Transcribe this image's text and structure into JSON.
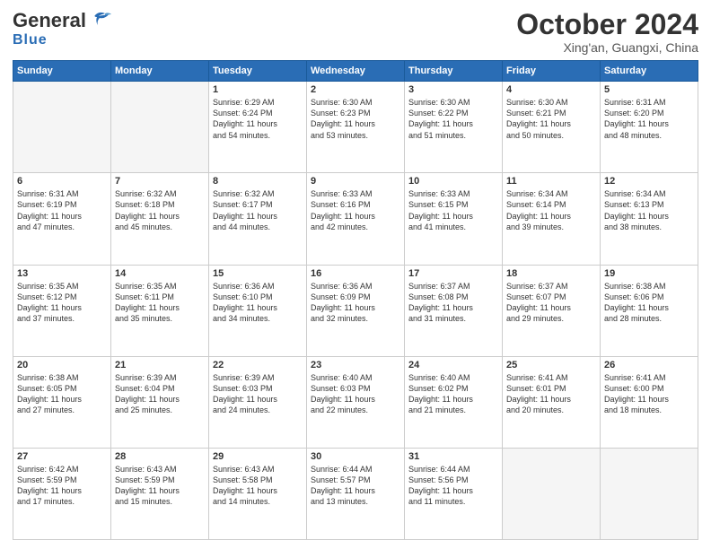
{
  "header": {
    "logo_line1": "General",
    "logo_line2": "Blue",
    "month_title": "October 2024",
    "location": "Xing'an, Guangxi, China"
  },
  "weekdays": [
    "Sunday",
    "Monday",
    "Tuesday",
    "Wednesday",
    "Thursday",
    "Friday",
    "Saturday"
  ],
  "weeks": [
    [
      {
        "day": "",
        "lines": [],
        "empty": true
      },
      {
        "day": "",
        "lines": [],
        "empty": true
      },
      {
        "day": "1",
        "lines": [
          "Sunrise: 6:29 AM",
          "Sunset: 6:24 PM",
          "Daylight: 11 hours",
          "and 54 minutes."
        ],
        "empty": false
      },
      {
        "day": "2",
        "lines": [
          "Sunrise: 6:30 AM",
          "Sunset: 6:23 PM",
          "Daylight: 11 hours",
          "and 53 minutes."
        ],
        "empty": false
      },
      {
        "day": "3",
        "lines": [
          "Sunrise: 6:30 AM",
          "Sunset: 6:22 PM",
          "Daylight: 11 hours",
          "and 51 minutes."
        ],
        "empty": false
      },
      {
        "day": "4",
        "lines": [
          "Sunrise: 6:30 AM",
          "Sunset: 6:21 PM",
          "Daylight: 11 hours",
          "and 50 minutes."
        ],
        "empty": false
      },
      {
        "day": "5",
        "lines": [
          "Sunrise: 6:31 AM",
          "Sunset: 6:20 PM",
          "Daylight: 11 hours",
          "and 48 minutes."
        ],
        "empty": false
      }
    ],
    [
      {
        "day": "6",
        "lines": [
          "Sunrise: 6:31 AM",
          "Sunset: 6:19 PM",
          "Daylight: 11 hours",
          "and 47 minutes."
        ],
        "empty": false
      },
      {
        "day": "7",
        "lines": [
          "Sunrise: 6:32 AM",
          "Sunset: 6:18 PM",
          "Daylight: 11 hours",
          "and 45 minutes."
        ],
        "empty": false
      },
      {
        "day": "8",
        "lines": [
          "Sunrise: 6:32 AM",
          "Sunset: 6:17 PM",
          "Daylight: 11 hours",
          "and 44 minutes."
        ],
        "empty": false
      },
      {
        "day": "9",
        "lines": [
          "Sunrise: 6:33 AM",
          "Sunset: 6:16 PM",
          "Daylight: 11 hours",
          "and 42 minutes."
        ],
        "empty": false
      },
      {
        "day": "10",
        "lines": [
          "Sunrise: 6:33 AM",
          "Sunset: 6:15 PM",
          "Daylight: 11 hours",
          "and 41 minutes."
        ],
        "empty": false
      },
      {
        "day": "11",
        "lines": [
          "Sunrise: 6:34 AM",
          "Sunset: 6:14 PM",
          "Daylight: 11 hours",
          "and 39 minutes."
        ],
        "empty": false
      },
      {
        "day": "12",
        "lines": [
          "Sunrise: 6:34 AM",
          "Sunset: 6:13 PM",
          "Daylight: 11 hours",
          "and 38 minutes."
        ],
        "empty": false
      }
    ],
    [
      {
        "day": "13",
        "lines": [
          "Sunrise: 6:35 AM",
          "Sunset: 6:12 PM",
          "Daylight: 11 hours",
          "and 37 minutes."
        ],
        "empty": false
      },
      {
        "day": "14",
        "lines": [
          "Sunrise: 6:35 AM",
          "Sunset: 6:11 PM",
          "Daylight: 11 hours",
          "and 35 minutes."
        ],
        "empty": false
      },
      {
        "day": "15",
        "lines": [
          "Sunrise: 6:36 AM",
          "Sunset: 6:10 PM",
          "Daylight: 11 hours",
          "and 34 minutes."
        ],
        "empty": false
      },
      {
        "day": "16",
        "lines": [
          "Sunrise: 6:36 AM",
          "Sunset: 6:09 PM",
          "Daylight: 11 hours",
          "and 32 minutes."
        ],
        "empty": false
      },
      {
        "day": "17",
        "lines": [
          "Sunrise: 6:37 AM",
          "Sunset: 6:08 PM",
          "Daylight: 11 hours",
          "and 31 minutes."
        ],
        "empty": false
      },
      {
        "day": "18",
        "lines": [
          "Sunrise: 6:37 AM",
          "Sunset: 6:07 PM",
          "Daylight: 11 hours",
          "and 29 minutes."
        ],
        "empty": false
      },
      {
        "day": "19",
        "lines": [
          "Sunrise: 6:38 AM",
          "Sunset: 6:06 PM",
          "Daylight: 11 hours",
          "and 28 minutes."
        ],
        "empty": false
      }
    ],
    [
      {
        "day": "20",
        "lines": [
          "Sunrise: 6:38 AM",
          "Sunset: 6:05 PM",
          "Daylight: 11 hours",
          "and 27 minutes."
        ],
        "empty": false
      },
      {
        "day": "21",
        "lines": [
          "Sunrise: 6:39 AM",
          "Sunset: 6:04 PM",
          "Daylight: 11 hours",
          "and 25 minutes."
        ],
        "empty": false
      },
      {
        "day": "22",
        "lines": [
          "Sunrise: 6:39 AM",
          "Sunset: 6:03 PM",
          "Daylight: 11 hours",
          "and 24 minutes."
        ],
        "empty": false
      },
      {
        "day": "23",
        "lines": [
          "Sunrise: 6:40 AM",
          "Sunset: 6:03 PM",
          "Daylight: 11 hours",
          "and 22 minutes."
        ],
        "empty": false
      },
      {
        "day": "24",
        "lines": [
          "Sunrise: 6:40 AM",
          "Sunset: 6:02 PM",
          "Daylight: 11 hours",
          "and 21 minutes."
        ],
        "empty": false
      },
      {
        "day": "25",
        "lines": [
          "Sunrise: 6:41 AM",
          "Sunset: 6:01 PM",
          "Daylight: 11 hours",
          "and 20 minutes."
        ],
        "empty": false
      },
      {
        "day": "26",
        "lines": [
          "Sunrise: 6:41 AM",
          "Sunset: 6:00 PM",
          "Daylight: 11 hours",
          "and 18 minutes."
        ],
        "empty": false
      }
    ],
    [
      {
        "day": "27",
        "lines": [
          "Sunrise: 6:42 AM",
          "Sunset: 5:59 PM",
          "Daylight: 11 hours",
          "and 17 minutes."
        ],
        "empty": false
      },
      {
        "day": "28",
        "lines": [
          "Sunrise: 6:43 AM",
          "Sunset: 5:59 PM",
          "Daylight: 11 hours",
          "and 15 minutes."
        ],
        "empty": false
      },
      {
        "day": "29",
        "lines": [
          "Sunrise: 6:43 AM",
          "Sunset: 5:58 PM",
          "Daylight: 11 hours",
          "and 14 minutes."
        ],
        "empty": false
      },
      {
        "day": "30",
        "lines": [
          "Sunrise: 6:44 AM",
          "Sunset: 5:57 PM",
          "Daylight: 11 hours",
          "and 13 minutes."
        ],
        "empty": false
      },
      {
        "day": "31",
        "lines": [
          "Sunrise: 6:44 AM",
          "Sunset: 5:56 PM",
          "Daylight: 11 hours",
          "and 11 minutes."
        ],
        "empty": false
      },
      {
        "day": "",
        "lines": [],
        "empty": true
      },
      {
        "day": "",
        "lines": [],
        "empty": true
      }
    ]
  ]
}
